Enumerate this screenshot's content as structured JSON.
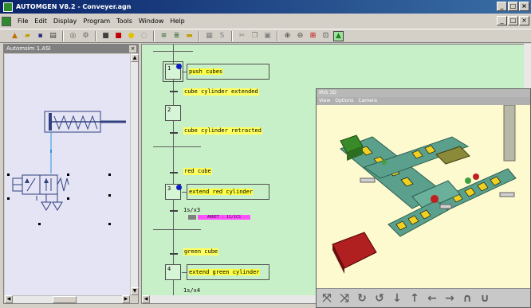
{
  "app": {
    "title": "AUTOMGEN V8.2 - Conveyer.agn"
  },
  "menu": [
    "File",
    "Edit",
    "Display",
    "Program",
    "Tools",
    "Window",
    "Help"
  ],
  "left_panel": {
    "title": "Automsim 1.ASI"
  },
  "grafcet": {
    "steps": [
      {
        "num": "1",
        "action": "push cubes"
      },
      {
        "num": "2",
        "action": ""
      },
      {
        "num": "3",
        "action": "extend red cylinder"
      },
      {
        "num": "4",
        "action": "extend green cylinder"
      }
    ],
    "transitions": {
      "t1": "cube cylinder extended",
      "t2": "cube cylinder retracted",
      "t3": "red cube",
      "t4": "green cube"
    },
    "timer_label": "1s/x3",
    "timer2_label": "1s/x4",
    "progress_label": "ARRET : 1S/1CS",
    "progress_value": 0.7
  },
  "iris": {
    "title": "IRIS 3D",
    "menu": [
      "View",
      "Options",
      "Camera"
    ]
  },
  "colors": {
    "grafcet_bg": "#c8f0c8",
    "scene_bg": "#fdfad0",
    "conveyor": "#5aa08c",
    "chevron": "#f0d020"
  }
}
